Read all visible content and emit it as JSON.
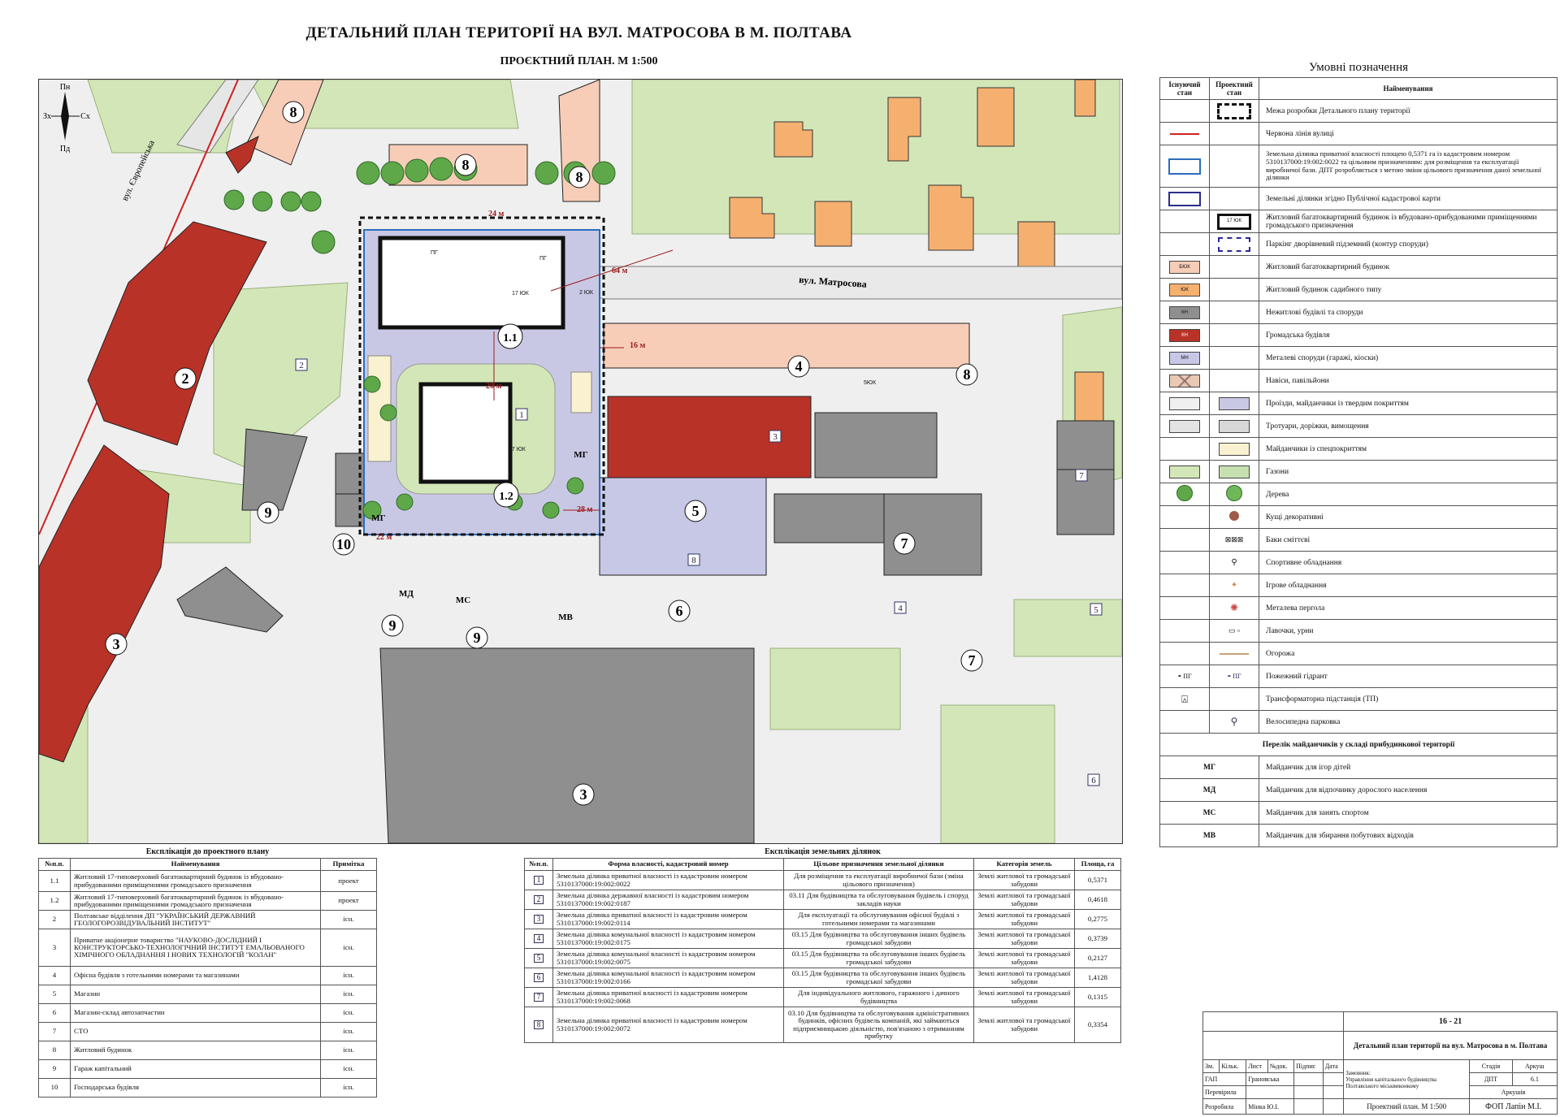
{
  "title": "ДЕТАЛЬНИЙ ПЛАН ТЕРИТОРІЇ НА ВУЛ. МАТРОСОВА В М. ПОЛТАВА",
  "subtitle": "ПРОЄКТНИЙ ПЛАН. М 1:500",
  "map": {
    "street_matrosova": "вул. Матросова",
    "street_yevropeiska": "вул. Європейська",
    "compass": {
      "n": "Пн",
      "s": "Пд",
      "w": "Зх",
      "e": "Сх"
    },
    "buildings": [
      "1.1",
      "1.2",
      "2",
      "3",
      "3",
      "4",
      "5",
      "6",
      "7",
      "7",
      "8",
      "8",
      "8",
      "8",
      "9",
      "9",
      "9",
      "9",
      "10"
    ],
    "parcels": [
      "1",
      "2",
      "3",
      "4",
      "5",
      "6",
      "7",
      "8"
    ],
    "playgrounds": {
      "mg1": "МГ",
      "mg2": "МГ",
      "md": "МД",
      "ms": "МС",
      "mv": "МВ"
    },
    "labels": {
      "uk17_1": "17 ЮК",
      "uk2_1": "2 ЮК",
      "uk17_2": "17 ЮК",
      "pg1": "ПГ",
      "pg2": "ПГ",
      "kn": "КН",
      "yk": "ЮК",
      "byk": "5ЮК",
      "d16": "16 м",
      "d20": "20 м",
      "d28": "28 м",
      "d22": "22 м",
      "d64": "64 м",
      "d24": "24 м"
    }
  },
  "legend": {
    "title": "Умовні позначення",
    "head": {
      "existing": "Існуючий стан",
      "project": "Проектний стан",
      "name": "Найменування"
    },
    "items": [
      "Межа розробки Детального плану території",
      "Червона лінія вулиці",
      "Земельна ділянка приватної власності площею 0,5371 га із кадастровим номером 5310137000:19:002:0022 та цільовим призначенням: для розміщення та експлуатації виробничої бази. ДПТ розробляється з метою зміни цільового призначення даної земельної ділянки",
      "Земельні ділянки згідно Публічної кадастрової карти",
      "Житловий багатоквартирний будинок із вбудовано-прибудованими приміщеннями громадського призначення",
      "Паркінг дворівневий підземний (контур споруди)",
      "Житловий багатоквартирний будинок",
      "Житловий будинок садибного типу",
      "Нежитлові будівлі та споруди",
      "Громадська будівля",
      "Металеві споруди (гаражі, кіоски)",
      "Навіси, павільйони",
      "Проїзди, майданчики із твердим покриттям",
      "Тротуари, доріжки, вимощення",
      "Майданчики із спецпокриттям",
      "Газони",
      "Дерева",
      "Кущі декоративні",
      "Баки сміттєві",
      "Спортивне обладнання",
      "Ігрове обладнання",
      "Металева пергола",
      "Лавочки, урни",
      "Огорожа",
      "Пожежний гідрант",
      "Трансформаторна підстанція (ТП)",
      "Велосипедна парковка"
    ],
    "swatch_labels": {
      "uk17": "17 ЮК",
      "byk": "БЮК",
      "yk": "ЮК",
      "kn": "КН",
      "gb": "КН",
      "mn": "МН",
      "pg": "ПГ"
    },
    "playground_header": "Перелік майданчиків у складі прибудинкової території",
    "playgrounds": [
      {
        "code": "МГ",
        "name": "Майданчик для ігор дітей"
      },
      {
        "code": "МД",
        "name": "Майданчик для відпочинку дорослого населення"
      },
      {
        "code": "МС",
        "name": "Майданчик для занять спортом"
      },
      {
        "code": "МВ",
        "name": "Майданчик для збирання побутових відходів"
      }
    ]
  },
  "expl1": {
    "caption": "Експлікація до проектного плану",
    "head": {
      "no": "№п.п.",
      "name": "Найменування",
      "note": "Примітка"
    },
    "rows": [
      {
        "no": "1.1",
        "name": "Житловий 17-типоверховий багатоквартирний будинок із вбудовано-прибудованими приміщеннями громадського призначення",
        "note": "проект"
      },
      {
        "no": "1.2",
        "name": "Житловий 17-типоверховий багатоквартирний будинок із вбудовано-прибудованими приміщеннями громадського призначення",
        "note": "проект"
      },
      {
        "no": "2",
        "name": "Полтавське відділення ДП \"УКРАЇНСЬКИЙ ДЕРЖАВНИЙ ГЕОЛОГОРОЗВІДУВАЛЬНИЙ ІНСТИТУТ\"",
        "note": "існ."
      },
      {
        "no": "3",
        "name": "Приватне акціонерне товариство \"НАУКОВО-ДОСЛІДНИЙ І КОНСТРУКТОРСЬКО-ТЕХНОЛОГІЧНИЙ ІНСТИТУТ ЕМАЛЬОВАНОГО ХІМІЧНОГО ОБЛАДНАННЯ І НОВИХ ТЕХНОЛОГІЙ \"КОЛАН\"",
        "note": "існ."
      },
      {
        "no": "4",
        "name": "Офісна будівля з готельними номерами та магазинами",
        "note": "існ."
      },
      {
        "no": "5",
        "name": "Магазин",
        "note": "існ."
      },
      {
        "no": "6",
        "name": "Магазин-склад автозапчастин",
        "note": "існ."
      },
      {
        "no": "7",
        "name": "СТО",
        "note": "існ."
      },
      {
        "no": "8",
        "name": "Житловий будинок",
        "note": "існ."
      },
      {
        "no": "9",
        "name": "Гараж капітальний",
        "note": "існ."
      },
      {
        "no": "10",
        "name": "Господарська будівля",
        "note": "існ."
      }
    ]
  },
  "expl2": {
    "caption": "Експлікація земельних ділянок",
    "head": {
      "no": "№п.п.",
      "form": "Форма власності, кадастровий номер",
      "purpose": "Цільове призначення земельної ділянки",
      "cat": "Категорія земель",
      "area": "Площа, га"
    },
    "rows": [
      {
        "no": "1",
        "form": "Земельна ділянка приватної власності із кадастровим номером 5310137000:19:002:0022",
        "purpose": "Для розміщення та експлуатації виробничої бази (зміна цільового призначення)",
        "cat": "Землі житлової та громадської забудови",
        "area": "0,5371"
      },
      {
        "no": "2",
        "form": "Земельна ділянка державної власності із кадастровим номером 5310137000:19:002:0187",
        "purpose": "03.11 Для будівництва та обслуговування будівель і споруд закладів науки",
        "cat": "Землі житлової та громадської забудови",
        "area": "0,4618"
      },
      {
        "no": "3",
        "form": "Земельна ділянка приватної власності із кадастровим номером 5310137000:19:002:0114",
        "purpose": "Для експлуатації та обслуговування офісної будівлі з готельними номерами та магазинами",
        "cat": "Землі житлової та громадської забудови",
        "area": "0,2775"
      },
      {
        "no": "4",
        "form": "Земельна ділянка комунальної власності із кадастровим номером 5310137000:19:002:0175",
        "purpose": "03.15 Для будівництва та обслуговування інших будівель громадської забудови",
        "cat": "Землі житлової та громадської забудови",
        "area": "0,3739"
      },
      {
        "no": "5",
        "form": "Земельна ділянка комунальної власності із кадастровим номером 5310137000:19:002:0075",
        "purpose": "03.15 Для будівництва та обслуговування інших будівель громадської забудови",
        "cat": "Землі житлової та громадської забудови",
        "area": "0,2127"
      },
      {
        "no": "6",
        "form": "Земельна ділянка комунальної власності із кадастровим номером 5310137000:19:002:0166",
        "purpose": "03.15 Для будівництва та обслуговування інших будівель громадської забудови",
        "cat": "Землі житлової та громадської забудови",
        "area": "1,4128"
      },
      {
        "no": "7",
        "form": "Земельна ділянка приватної власності із кадастровим номером 5310137000:19:002:0068",
        "purpose": "Для індивідуального житлового, гаражного і дачного будівництва",
        "cat": "Землі житлової та громадської забудови",
        "area": "0,1315"
      },
      {
        "no": "8",
        "form": "Земельна ділянка приватної власності із кадастровим номером 5310137000:19:002:0072",
        "purpose": "03.10 Для будівництва та обслуговування адміністративних будинків, офісних будівель компаній, які займаються підприємницькою діяльністю, пов'язаною з отриманням прибутку",
        "cat": "Землі житлової та громадської забудови",
        "area": "0,3354"
      }
    ]
  },
  "stamp": {
    "code": "16 - 21",
    "project": "Детальний план території на вул. Матросова в м. Полтава",
    "cols": [
      "Зм.",
      "Кільк.",
      "Лист",
      "№док.",
      "Підпис",
      "Дата"
    ],
    "gap_role": "ГАП",
    "gap_name": "Грановська",
    "checked": "Перевірила",
    "developed": "Розробила",
    "dev_name": "Мінка Ю.І.",
    "client_label": "Замовник:",
    "client": "Управління капітального будівництва Полтавського міськвиконкому",
    "stage_h": "Стадія",
    "sheet_h": "Аркуш",
    "sheets_h": "Аркушів",
    "stage": "ДПТ",
    "sheet": "6.1",
    "sheet_title": "Проектний план. М 1:500",
    "company": "ФОП Лапін М.І."
  }
}
